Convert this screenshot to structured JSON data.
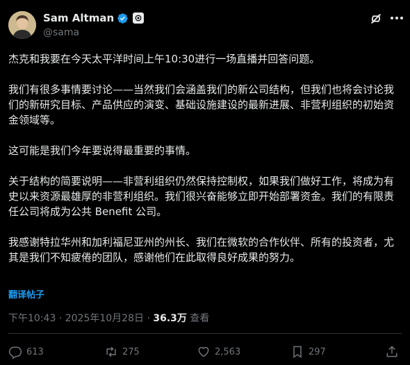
{
  "author": {
    "name": "Sam Altman",
    "handle": "@sama",
    "verified_color": "#1d9bf0"
  },
  "post": {
    "paragraphs": [
      "杰克和我要在今天太平洋时间上午10:30进行一场直播并回答问题。",
      "我们有很多事情要讨论——当然我们会涵盖我们的新公司结构，但我们也将会讨论我们的新研究目标、产品供应的演变、基础设施建设的最新进展、非营利组织的初始资金领域等。",
      "这可能是我们今年要说得最重要的事情。",
      "关于结构的简要说明——非营利组织仍然保持控制权，如果我们做好工作，将成为有史以来资源最雄厚的非营利组织。我们很兴奋能够立即开始部署资金。我们的有限责任公司将成为公共 Benefit 公司。",
      "我感谢特拉华州和加利福尼亚州的州长、我们在微软的合作伙伴、所有的投资者，尤其是我们不知疲倦的团队，感谢他们在此取得良好成果的努力。"
    ],
    "translate_label": "翻译帖子"
  },
  "meta": {
    "time": "下午10:43",
    "date": "2025年10月28日",
    "views_count": "36.3万",
    "views_label": "查看"
  },
  "actions": {
    "replies": "613",
    "reposts": "275",
    "likes": "2,563",
    "bookmarks": "297"
  }
}
